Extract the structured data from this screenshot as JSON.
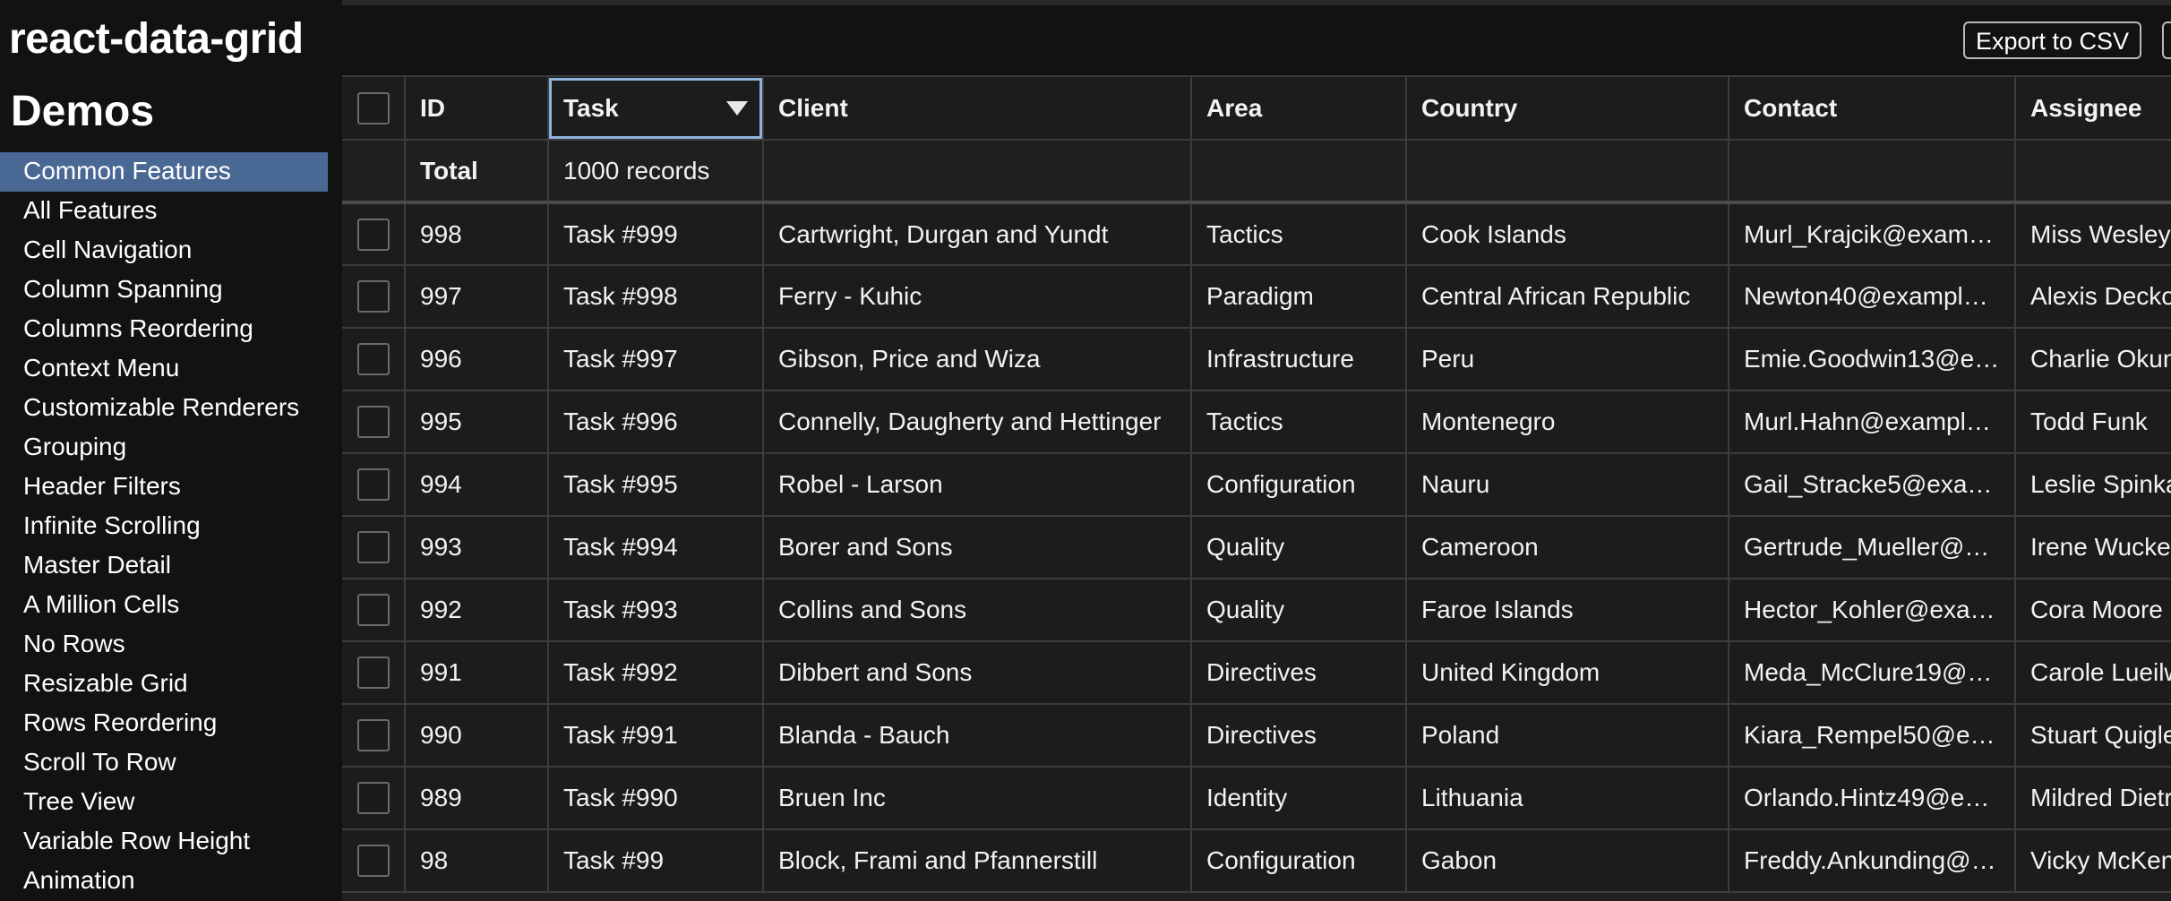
{
  "brand": "react-data-grid",
  "sidebar": {
    "heading": "Demos",
    "items": [
      "Common Features",
      "All Features",
      "Cell Navigation",
      "Column Spanning",
      "Columns Reordering",
      "Context Menu",
      "Customizable Renderers",
      "Grouping",
      "Header Filters",
      "Infinite Scrolling",
      "Master Detail",
      "A Million Cells",
      "No Rows",
      "Resizable Grid",
      "Rows Reordering",
      "Scroll To Row",
      "Tree View",
      "Variable Row Height",
      "Animation"
    ],
    "active_index": 0
  },
  "toolbar": {
    "export_label": "Export to CSV"
  },
  "grid": {
    "columns": [
      "ID",
      "Task",
      "Client",
      "Area",
      "Country",
      "Contact",
      "Assignee"
    ],
    "summary": {
      "label": "Total",
      "records": "1000 records"
    },
    "rows": [
      [
        "998",
        "Task #999",
        "Cartwright, Durgan and Yundt",
        "Tactics",
        "Cook Islands",
        "Murl_Krajcik@exam…",
        "Miss Wesley"
      ],
      [
        "997",
        "Task #998",
        "Ferry - Kuhic",
        "Paradigm",
        "Central African Republic",
        "Newton40@exampl…",
        "Alexis Decko"
      ],
      [
        "996",
        "Task #997",
        "Gibson, Price and Wiza",
        "Infrastructure",
        "Peru",
        "Emie.Goodwin13@e…",
        "Charlie Okun"
      ],
      [
        "995",
        "Task #996",
        "Connelly, Daugherty and Hettinger",
        "Tactics",
        "Montenegro",
        "Murl.Hahn@exampl…",
        "Todd Funk"
      ],
      [
        "994",
        "Task #995",
        "Robel - Larson",
        "Configuration",
        "Nauru",
        "Gail_Stracke5@exa…",
        "Leslie Spinka"
      ],
      [
        "993",
        "Task #994",
        "Borer and Sons",
        "Quality",
        "Cameroon",
        "Gertrude_Mueller@…",
        "Irene Wucke"
      ],
      [
        "992",
        "Task #993",
        "Collins and Sons",
        "Quality",
        "Faroe Islands",
        "Hector_Kohler@exa…",
        "Cora Moore"
      ],
      [
        "991",
        "Task #992",
        "Dibbert and Sons",
        "Directives",
        "United Kingdom",
        "Meda_McClure19@…",
        "Carole Lueilw"
      ],
      [
        "990",
        "Task #991",
        "Blanda - Bauch",
        "Directives",
        "Poland",
        "Kiara_Rempel50@e…",
        "Stuart Quigle"
      ],
      [
        "989",
        "Task #990",
        "Bruen Inc",
        "Identity",
        "Lithuania",
        "Orlando.Hintz49@e…",
        "Mildred Dietr"
      ],
      [
        "98",
        "Task #99",
        "Block, Frami and Pfannerstill",
        "Configuration",
        "Gabon",
        "Freddy.Ankunding@…",
        "Vicky McKen"
      ]
    ]
  }
}
